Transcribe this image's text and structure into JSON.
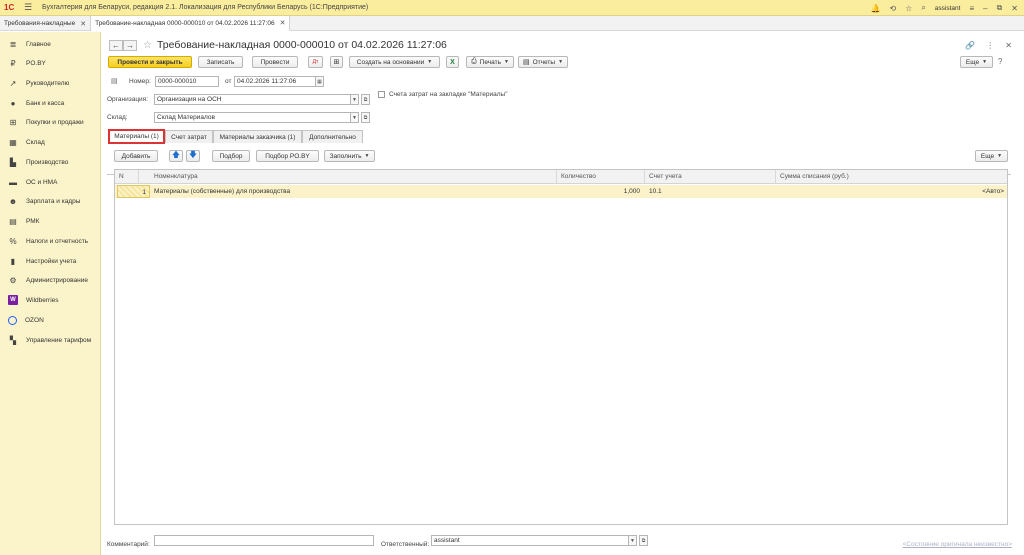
{
  "app": {
    "title": "Бухгалтерия для Беларуси, редакция 2.1. Локализация для Республики Беларусь   (1С:Предприятие)",
    "user": "assistant"
  },
  "tabs": [
    {
      "label": "Требования-накладные"
    },
    {
      "label": "Требование-накладная 0000-000010 от 04.02.2026 11:27:06"
    }
  ],
  "sidebar": {
    "items": [
      {
        "label": "Главное",
        "icon": "menu-lines-icon"
      },
      {
        "label": "PO.BY",
        "icon": "p-icon"
      },
      {
        "label": "Руководителю",
        "icon": "trend-icon"
      },
      {
        "label": "Банк и касса",
        "icon": "bank-icon"
      },
      {
        "label": "Покупки и продажи",
        "icon": "cart-icon"
      },
      {
        "label": "Склад",
        "icon": "warehouse-icon"
      },
      {
        "label": "Производство",
        "icon": "factory-icon"
      },
      {
        "label": "ОС и НМА",
        "icon": "truck-icon"
      },
      {
        "label": "Зарплата и кадры",
        "icon": "people-icon"
      },
      {
        "label": "РМК",
        "icon": "terminal-icon"
      },
      {
        "label": "Налоги и отчетность",
        "icon": "percent-icon"
      },
      {
        "label": "Настройки учета",
        "icon": "book-icon"
      },
      {
        "label": "Администрирование",
        "icon": "gear-icon"
      },
      {
        "label": "Wildberries",
        "icon": "wildberries-icon"
      },
      {
        "label": "OZON",
        "icon": "ozon-icon"
      },
      {
        "label": "Управление тарифом",
        "icon": "tariff-icon"
      }
    ]
  },
  "document": {
    "title": "Требование-накладная 0000-000010 от 04.02.2026 11:27:06"
  },
  "toolbar": {
    "post_close": "Провести и закрыть",
    "save": "Записать",
    "post": "Провести",
    "create_based": "Создать на основании",
    "print": "Печать",
    "reports": "Отчеты",
    "more": "Еще"
  },
  "form": {
    "number_label": "Номер:",
    "number": "0000-000010",
    "date_label": "от",
    "date": "04.02.2026 11:27:06",
    "org_label": "Организация:",
    "org": "Организация на ОСН",
    "warehouse_label": "Склад:",
    "warehouse": "Склад Материалов",
    "accounts_checkbox": "Счета затрат на закладке \"Материалы\""
  },
  "form_tabs": [
    {
      "label": "Материалы (1)"
    },
    {
      "label": "Счет затрат"
    },
    {
      "label": "Материалы заказчика (1)"
    },
    {
      "label": "Дополнительно"
    }
  ],
  "table_toolbar": {
    "add": "Добавить",
    "selection": "Подбор",
    "selection_poby": "Подбор PO.BY",
    "fill": "Заполнить",
    "more": "Еще"
  },
  "table": {
    "columns": [
      "N",
      "Номенклатура",
      "Количество",
      "Счет учета",
      "Сумма списания (руб.)"
    ],
    "rows": [
      {
        "n": "1",
        "item": "Материалы (собственные) для производства",
        "qty": "1,000",
        "account": "10.1",
        "amount": "<Авто>"
      }
    ]
  },
  "footer": {
    "comment_label": "Комментарий:",
    "comment": "",
    "responsible_label": "Ответственный:",
    "responsible": "assistant",
    "status_link": "<Состояние оригинала неизвестно>"
  },
  "colors": {
    "accent_yellow": "#f4cf1f",
    "sidebar_bg": "#fbf3c9",
    "titlebar_bg": "#fbed9e",
    "active_tab_border": "#dd3333"
  }
}
